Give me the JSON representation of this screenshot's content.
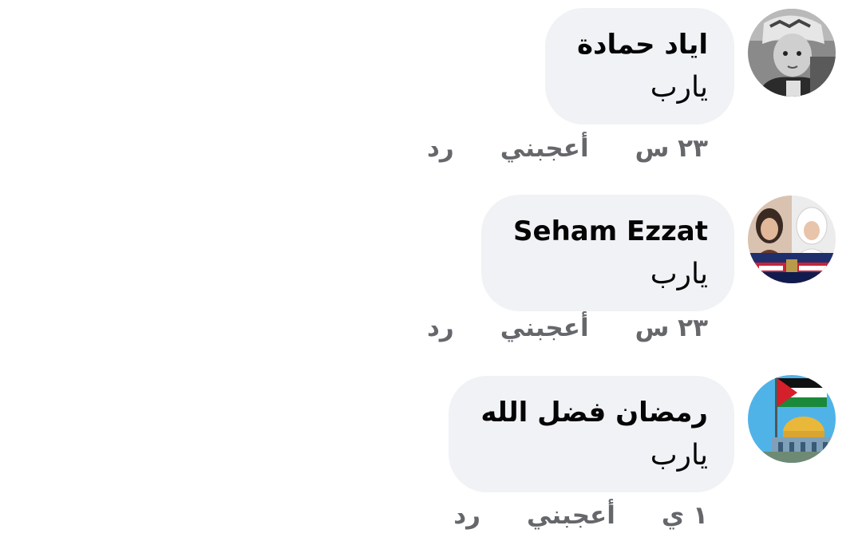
{
  "comments": [
    {
      "author": "اياد حمادة",
      "text": "يارب",
      "time": "٢٣ س",
      "like_label": "أعجبني",
      "reply_label": "رد",
      "avatar_icon": "child-photo-avatar"
    },
    {
      "author": "Seham Ezzat",
      "text": "يارب",
      "time": "٢٣ س",
      "like_label": "أعجبني",
      "reply_label": "رد",
      "avatar_icon": "two-women-photo-avatar"
    },
    {
      "author": "رمضان فضل الله",
      "text": "يارب",
      "time": "١ ي",
      "like_label": "أعجبني",
      "reply_label": "رد",
      "avatar_icon": "dome-of-rock-flag-avatar"
    }
  ],
  "colors": {
    "bubble_bg": "#f0f2f5",
    "text": "#050505",
    "meta_text": "#65676b"
  }
}
